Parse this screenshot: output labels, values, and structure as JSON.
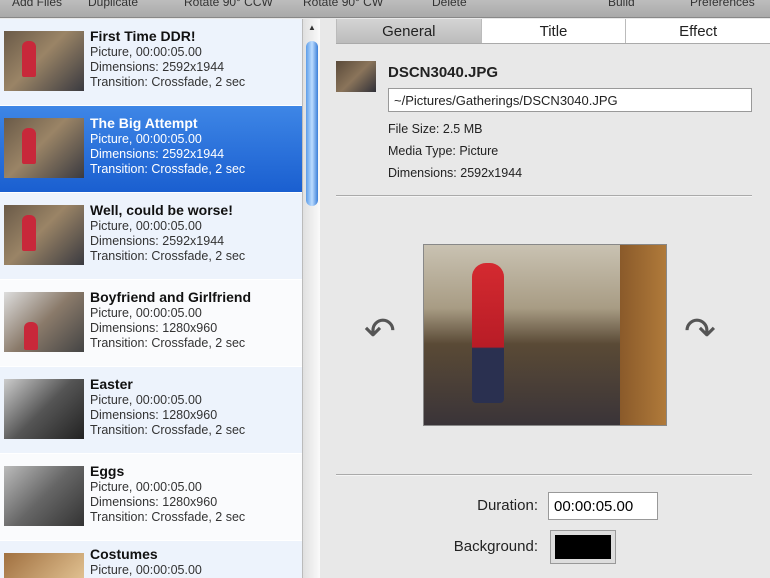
{
  "toolbar": {
    "add_files": "Add Files",
    "duplicate": "Duplicate",
    "rotate_ccw": "Rotate 90° CCW",
    "rotate_cw": "Rotate 90° CW",
    "delete": "Delete",
    "build": "Build",
    "preferences": "Preferences"
  },
  "items": [
    {
      "title": "First Time DDR!",
      "line1": "Picture, 00:00:05.00",
      "line2": "Dimensions: 2592x1944",
      "line3": "Transition: Crossfade, 2 sec"
    },
    {
      "title": "The Big Attempt",
      "line1": "Picture, 00:00:05.00",
      "line2": "Dimensions: 2592x1944",
      "line3": "Transition: Crossfade, 2 sec"
    },
    {
      "title": "Well, could be worse!",
      "line1": "Picture, 00:00:05.00",
      "line2": "Dimensions: 2592x1944",
      "line3": "Transition: Crossfade, 2 sec"
    },
    {
      "title": "Boyfriend and Girlfriend",
      "line1": "Picture, 00:00:05.00",
      "line2": "Dimensions: 1280x960",
      "line3": "Transition: Crossfade, 2 sec"
    },
    {
      "title": "Easter",
      "line1": "Picture, 00:00:05.00",
      "line2": "Dimensions: 1280x960",
      "line3": "Transition: Crossfade, 2 sec"
    },
    {
      "title": "Eggs",
      "line1": "Picture, 00:00:05.00",
      "line2": "Dimensions: 1280x960",
      "line3": "Transition: Crossfade, 2 sec"
    },
    {
      "title": "Costumes",
      "line1": "Picture, 00:00:05.00",
      "line2": "",
      "line3": ""
    }
  ],
  "tabs": {
    "general": "General",
    "title": "Title",
    "effect": "Effect"
  },
  "details": {
    "filename": "DSCN3040.JPG",
    "path": "~/Pictures/Gatherings/DSCN3040.JPG",
    "file_size": "File Size: 2.5 MB",
    "media_type": "Media Type: Picture",
    "dimensions": "Dimensions: 2592x1944"
  },
  "settings": {
    "duration_label": "Duration:",
    "duration": "00:00:05.00",
    "background_label": "Background:",
    "background_color": "#000000"
  }
}
